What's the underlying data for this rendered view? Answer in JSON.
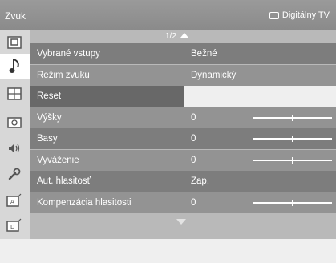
{
  "header": {
    "title": "Zvuk",
    "source_label": "Digitálny TV"
  },
  "pager": {
    "text": "1/2"
  },
  "sidebar": {
    "items": [
      {
        "icon": "input-icon"
      },
      {
        "icon": "music-note-icon",
        "active": true
      },
      {
        "icon": "picture-grid-icon"
      },
      {
        "icon": "camera-icon"
      },
      {
        "icon": "speaker-icon"
      },
      {
        "icon": "wrench-icon"
      },
      {
        "icon": "analog-channel-icon"
      },
      {
        "icon": "digital-channel-icon"
      }
    ]
  },
  "menu": {
    "rows": [
      {
        "label": "Vybrané vstupy",
        "value": "Bežné"
      },
      {
        "label": "Režim zvuku",
        "value": "Dynamický"
      },
      {
        "label": "Reset",
        "value": "",
        "selected": true
      },
      {
        "label": "Výšky",
        "value": "0",
        "slider_level": 0.5
      },
      {
        "label": "Basy",
        "value": "0",
        "slider_level": 0.5
      },
      {
        "label": "Vyváženie",
        "value": "0",
        "slider_level": 0.5
      },
      {
        "label": "Aut. hlasitosť",
        "value": "Zap."
      },
      {
        "label": "Kompenzácia hlasitosti",
        "value": "0",
        "slider_level": 0.5
      }
    ]
  }
}
